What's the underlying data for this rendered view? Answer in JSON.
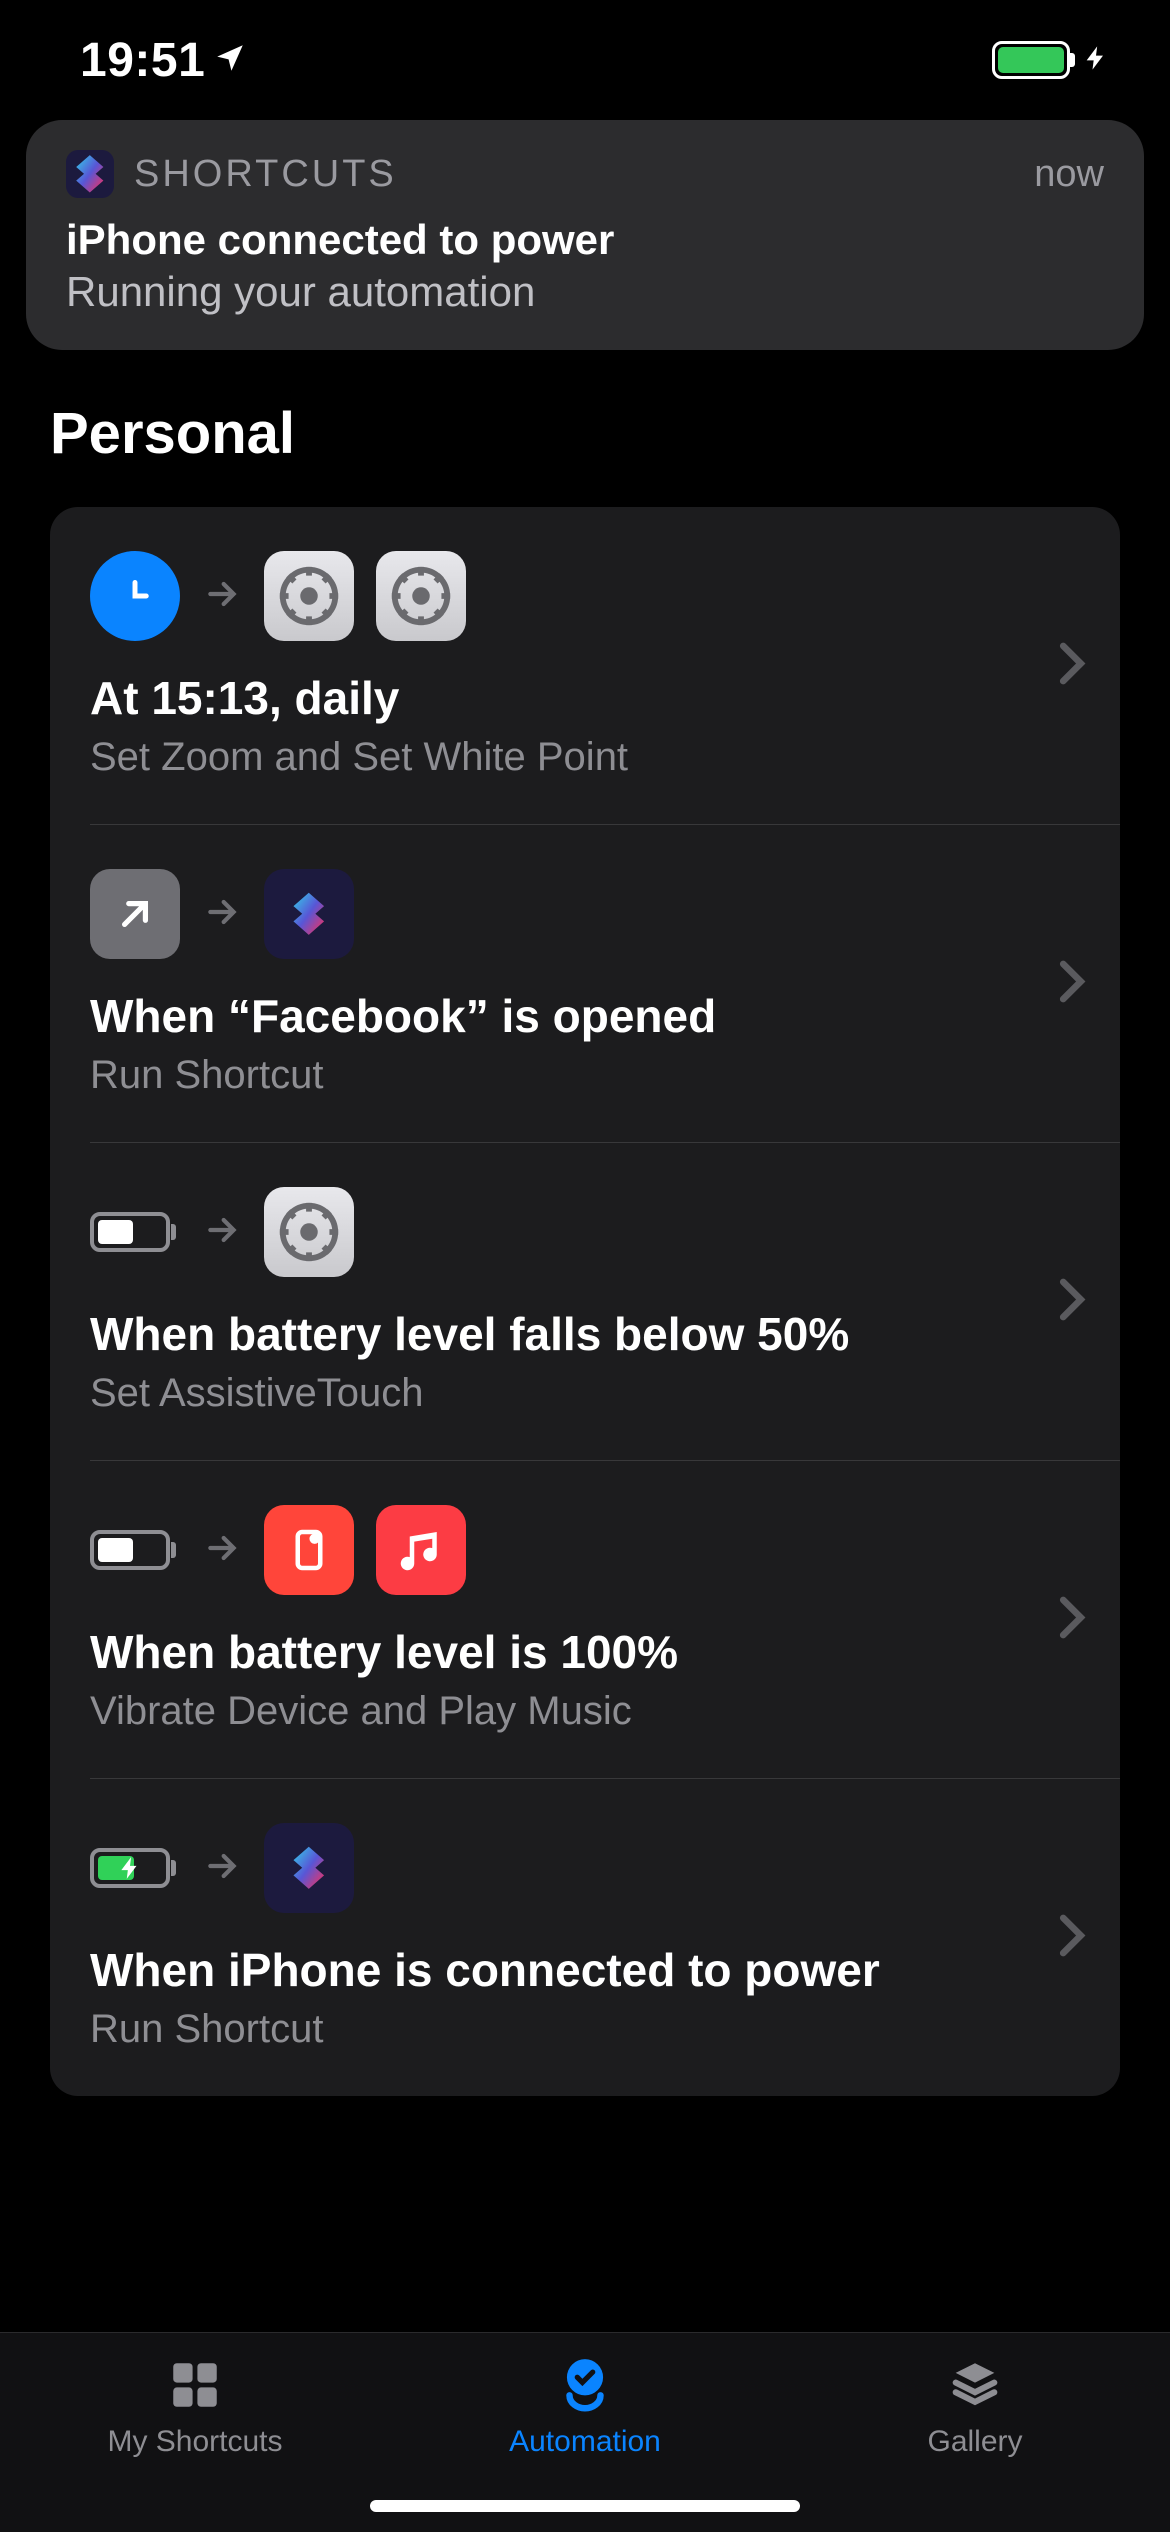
{
  "status": {
    "time": "19:51"
  },
  "notification": {
    "app": "SHORTCUTS",
    "time": "now",
    "title": "iPhone connected to power",
    "subtitle": "Running your automation"
  },
  "section_title": "Personal",
  "automations": [
    {
      "title": "At 15:13, daily",
      "subtitle": "Set Zoom and Set White Point"
    },
    {
      "title": "When “Facebook” is opened",
      "subtitle": "Run Shortcut"
    },
    {
      "title": "When battery level falls below 50%",
      "subtitle": "Set AssistiveTouch"
    },
    {
      "title": "When battery level is 100%",
      "subtitle": "Vibrate Device and Play Music"
    },
    {
      "title": "When iPhone is connected to power",
      "subtitle": "Run Shortcut"
    }
  ],
  "tabs": {
    "my_shortcuts": "My Shortcuts",
    "automation": "Automation",
    "gallery": "Gallery"
  }
}
